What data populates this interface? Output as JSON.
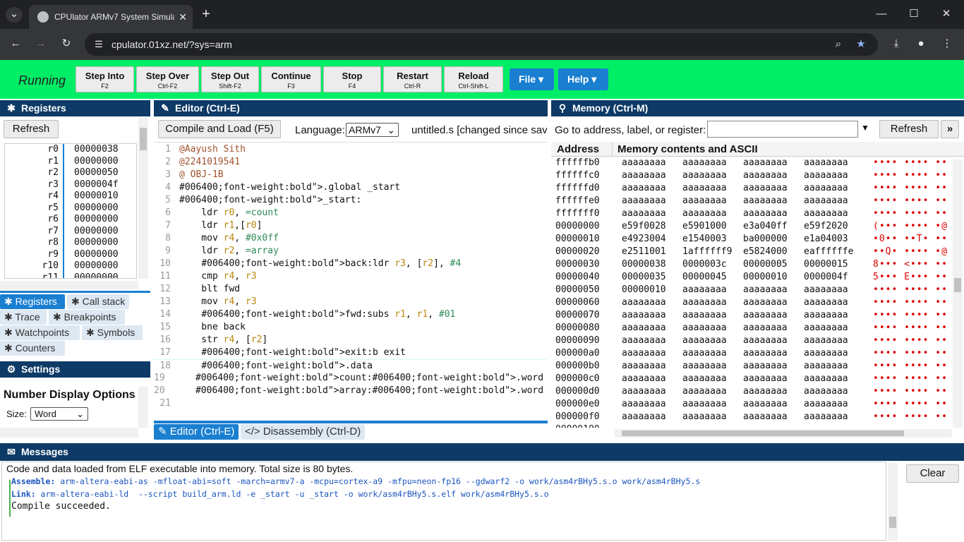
{
  "browser": {
    "tab_title": "CPUlator ARMv7 System Simula",
    "url": "cpulator.01xz.net/?sys=arm"
  },
  "toolbar": {
    "status": "Running",
    "buttons": [
      {
        "label": "Step Into",
        "key": "F2"
      },
      {
        "label": "Step Over",
        "key": "Ctrl-F2"
      },
      {
        "label": "Step Out",
        "key": "Shift-F2"
      },
      {
        "label": "Continue",
        "key": "F3"
      },
      {
        "label": "Stop",
        "key": "F4"
      },
      {
        "label": "Restart",
        "key": "Ctrl-R"
      },
      {
        "label": "Reload",
        "key": "Ctrl-Shift-L"
      }
    ],
    "file_label": "File",
    "help_label": "Help"
  },
  "registers": {
    "title": "Registers",
    "refresh": "Refresh",
    "rows": [
      {
        "n": "r0",
        "v": "00000038"
      },
      {
        "n": "r1",
        "v": "00000000"
      },
      {
        "n": "r2",
        "v": "00000050"
      },
      {
        "n": "r3",
        "v": "0000004f"
      },
      {
        "n": "r4",
        "v": "00000010"
      },
      {
        "n": "r5",
        "v": "00000000"
      },
      {
        "n": "r6",
        "v": "00000000"
      },
      {
        "n": "r7",
        "v": "00000000"
      },
      {
        "n": "r8",
        "v": "00000000"
      },
      {
        "n": "r9",
        "v": "00000000"
      },
      {
        "n": "r10",
        "v": "00000000"
      },
      {
        "n": "r11",
        "v": "00000000"
      }
    ],
    "tabs": [
      "Registers",
      "Call stack",
      "Trace",
      "Breakpoints",
      "Watchpoints",
      "Symbols",
      "Counters"
    ]
  },
  "settings": {
    "title": "Settings",
    "section": "Number Display Options",
    "size_label": "Size:",
    "size_value": "Word"
  },
  "editor": {
    "title": "Editor (Ctrl-E)",
    "compile": "Compile and Load (F5)",
    "language_label": "Language:",
    "language_value": "ARMv7",
    "filename": "untitled.s [changed since sav",
    "lines": [
      "@Aayush Sith",
      "@2241019541",
      "@ OBJ-1B",
      ".global _start",
      "_start:",
      "    ldr r0, =count",
      "    ldr r1,[r0]",
      "    mov r4, #0x0ff",
      "    ldr r2, =array",
      "    back:ldr r3, [r2], #4",
      "    cmp r4, r3",
      "    blt fwd",
      "    mov r4, r3",
      "    fwd:subs r1, r1, #01",
      "    bne back",
      "    str r4, [r2]",
      "    exit:b exit",
      "    .data",
      "    count:.word 0x05",
      "    array:.word 0x15, 0x35, 0x45, 0x10, 0x4f",
      ""
    ],
    "tab_editor": "Editor (Ctrl-E)",
    "tab_disasm": "Disassembly (Ctrl-D)"
  },
  "memory": {
    "title": "Memory (Ctrl-M)",
    "goto_label": "Go to address, label, or register:",
    "refresh": "Refresh",
    "col_address": "Address",
    "col_contents": "Memory contents and ASCII",
    "rows": [
      {
        "a": "ffffffb0",
        "w": [
          "aaaaaaaa",
          "aaaaaaaa",
          "aaaaaaaa",
          "aaaaaaaa"
        ],
        "s": "•••• •••• ••"
      },
      {
        "a": "ffffffc0",
        "w": [
          "aaaaaaaa",
          "aaaaaaaa",
          "aaaaaaaa",
          "aaaaaaaa"
        ],
        "s": "•••• •••• ••"
      },
      {
        "a": "ffffffd0",
        "w": [
          "aaaaaaaa",
          "aaaaaaaa",
          "aaaaaaaa",
          "aaaaaaaa"
        ],
        "s": "•••• •••• ••"
      },
      {
        "a": "ffffffe0",
        "w": [
          "aaaaaaaa",
          "aaaaaaaa",
          "aaaaaaaa",
          "aaaaaaaa"
        ],
        "s": "•••• •••• ••"
      },
      {
        "a": "fffffff0",
        "w": [
          "aaaaaaaa",
          "aaaaaaaa",
          "aaaaaaaa",
          "aaaaaaaa"
        ],
        "s": "•••• •••• ••"
      },
      {
        "a": "00000000",
        "w": [
          "e59f0028",
          "e5901000",
          "e3a040ff",
          "e59f2020"
        ],
        "s": "(••• •••• •@"
      },
      {
        "a": "00000010",
        "w": [
          "e4923004",
          "e1540003",
          "ba000000",
          "e1a04003"
        ],
        "s": "•0•• ••T• ••"
      },
      {
        "a": "00000020",
        "w": [
          "e2511001",
          "1affffff9",
          "e5824000",
          "eaffffffe"
        ],
        "s": "••Q• •••• •@"
      },
      {
        "a": "00000030",
        "w": [
          "00000038",
          "0000003c",
          "00000005",
          "00000015"
        ],
        "s": "8••• <••• ••"
      },
      {
        "a": "00000040",
        "w": [
          "00000035",
          "00000045",
          "00000010",
          "0000004f"
        ],
        "s": "5••• E••• ••"
      },
      {
        "a": "00000050",
        "w": [
          "00000010",
          "aaaaaaaa",
          "aaaaaaaa",
          "aaaaaaaa"
        ],
        "s": "•••• •••• ••"
      },
      {
        "a": "00000060",
        "w": [
          "aaaaaaaa",
          "aaaaaaaa",
          "aaaaaaaa",
          "aaaaaaaa"
        ],
        "s": "•••• •••• ••"
      },
      {
        "a": "00000070",
        "w": [
          "aaaaaaaa",
          "aaaaaaaa",
          "aaaaaaaa",
          "aaaaaaaa"
        ],
        "s": "•••• •••• ••"
      },
      {
        "a": "00000080",
        "w": [
          "aaaaaaaa",
          "aaaaaaaa",
          "aaaaaaaa",
          "aaaaaaaa"
        ],
        "s": "•••• •••• ••"
      },
      {
        "a": "00000090",
        "w": [
          "aaaaaaaa",
          "aaaaaaaa",
          "aaaaaaaa",
          "aaaaaaaa"
        ],
        "s": "•••• •••• ••"
      },
      {
        "a": "000000a0",
        "w": [
          "aaaaaaaa",
          "aaaaaaaa",
          "aaaaaaaa",
          "aaaaaaaa"
        ],
        "s": "•••• •••• ••"
      },
      {
        "a": "000000b0",
        "w": [
          "aaaaaaaa",
          "aaaaaaaa",
          "aaaaaaaa",
          "aaaaaaaa"
        ],
        "s": "•••• •••• ••"
      },
      {
        "a": "000000c0",
        "w": [
          "aaaaaaaa",
          "aaaaaaaa",
          "aaaaaaaa",
          "aaaaaaaa"
        ],
        "s": "•••• •••• ••"
      },
      {
        "a": "000000d0",
        "w": [
          "aaaaaaaa",
          "aaaaaaaa",
          "aaaaaaaa",
          "aaaaaaaa"
        ],
        "s": "•••• •••• ••"
      },
      {
        "a": "000000e0",
        "w": [
          "aaaaaaaa",
          "aaaaaaaa",
          "aaaaaaaa",
          "aaaaaaaa"
        ],
        "s": "•••• •••• ••"
      },
      {
        "a": "000000f0",
        "w": [
          "aaaaaaaa",
          "aaaaaaaa",
          "aaaaaaaa",
          "aaaaaaaa"
        ],
        "s": "•••• •••• ••"
      },
      {
        "a": "00000100",
        "w": [
          "",
          "",
          "",
          ""
        ],
        "s": ""
      }
    ]
  },
  "messages": {
    "title": "Messages",
    "clear": "Clear",
    "lines": [
      {
        "text": "Code and data loaded from ELF executable into memory. Total size is 80 bytes."
      },
      {
        "label": "Assemble:",
        "text": " arm-altera-eabi-as -mfloat-abi=soft -march=armv7-a -mcpu=cortex-a9 -mfpu=neon-fp16 --gdwarf2 -o work/asm4rBHy5.s.o work/asm4rBHy5.s"
      },
      {
        "label": "Link:",
        "text": " arm-altera-eabi-ld  --script build_arm.ld -e _start -u _start -o work/asm4rBHy5.s.elf work/asm4rBHy5.s.o"
      },
      {
        "text": "Compile succeeded."
      }
    ]
  },
  "colors": {
    "accent": "#1a7fd1",
    "toolbar": "#00ee66",
    "header": "#0d3a66"
  }
}
